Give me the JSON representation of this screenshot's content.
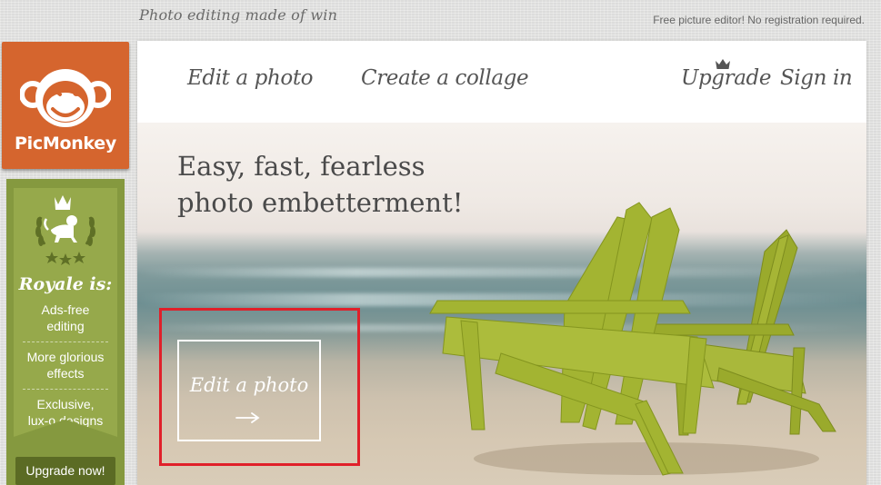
{
  "header": {
    "tagline": "Photo editing made of win",
    "note": "Free picture editor! No registration required."
  },
  "logo": {
    "text": "PicMonkey",
    "icon": "monkey-face-icon",
    "color": "#d5652e"
  },
  "royale": {
    "title": "Royale is:",
    "items": [
      {
        "label": "Ads-free editing",
        "lines": [
          "Ads-free",
          "editing"
        ]
      },
      {
        "label": "More glorious effects",
        "lines": [
          "More glorious",
          "effects"
        ]
      },
      {
        "label": "Exclusive, lux-o designs",
        "lines": [
          "Exclusive,",
          "lux-o designs"
        ]
      }
    ],
    "upgrade_button": "Upgrade now!",
    "badge_icon": "crowned-monkey-laurel-icon",
    "color": "#85993f"
  },
  "nav": {
    "edit_photo": "Edit a photo",
    "create_collage": "Create a collage",
    "upgrade": "Upgrade",
    "sign_in": "Sign in",
    "upgrade_icon": "crown-icon"
  },
  "hero": {
    "headline_line1": "Easy, fast, fearless",
    "headline_line2": "photo embetterment!",
    "cta_label": "Edit a photo",
    "cta_icon": "right-arrow-icon",
    "highlight_color": "#e0202a"
  }
}
